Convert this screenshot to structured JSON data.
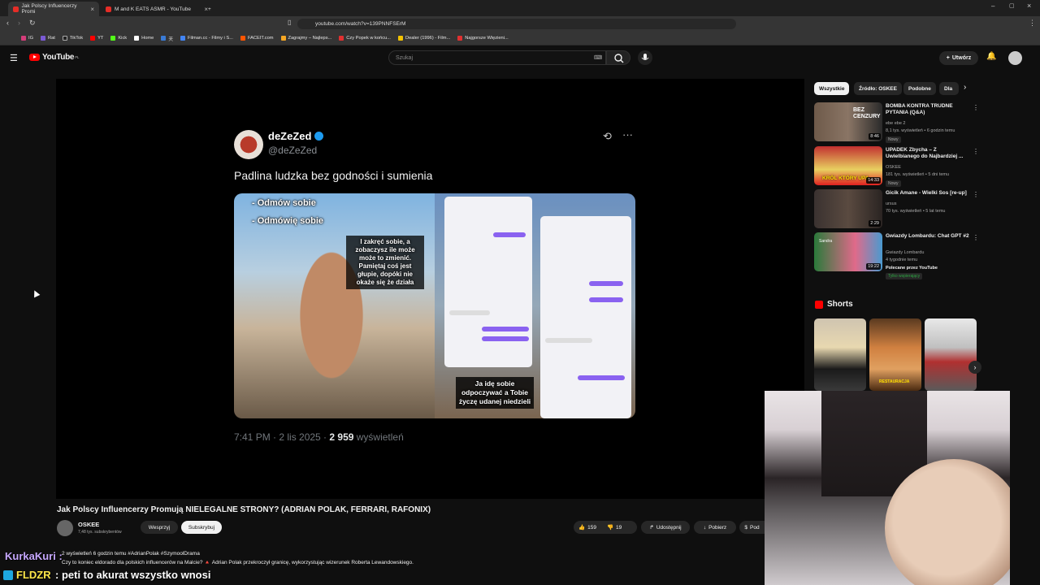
{
  "browser": {
    "tabs": [
      {
        "label": "Jak Polscy Influencerzy Promi"
      },
      {
        "label": "M and K EATS ASMR - YouTube"
      }
    ],
    "url": "youtube.com/watch?v=139PNNFSErM",
    "bookmarks": [
      "IG",
      "Rat",
      "TikTok",
      "YT",
      "Kick",
      "Home",
      "天",
      "Filman.cc - Filmy i S...",
      "FACEIT.com",
      "Zagrajmy – Najleps...",
      "Czy Popek w końcu...",
      "Dealer (1996) - Film...",
      "Najgorsze Więzieni..."
    ]
  },
  "header": {
    "logo": "YouTube",
    "logo_country": "PL",
    "search_placeholder": "Szukaj",
    "create_label": "Utwórz"
  },
  "tweet": {
    "display_name": "deZeZed",
    "handle": "@deZeZed",
    "text": "Padlina ludzka bez godności i sumienia",
    "caption_top1": "- Odmów sobie",
    "caption_top2": "- Odmówię sobie",
    "caption_mid": "I zakręć sobie, a zobaczysz ile może może to zmienić. Pamiętaj coś jest głupie, dopóki nie okaże się że działa",
    "caption_bottom": "Ja idę sobie odpoczywać a Tobie życzę udanej niedzieli",
    "time": "7:41 PM · 2 lis 2025 · ",
    "views_count": "2 959",
    "views_label": " wyświetleń"
  },
  "video": {
    "title": "Jak Polscy Influencerzy Promują NIELEGALNE STRONY? (ADRIAN POLAK, FERRARI, RAFONIX)",
    "channel": "OSKEE",
    "subscribers": "7,48 tys. subskrybentów",
    "support_label": "Wesprzyj",
    "subscribe_label": "Subskrybuj",
    "likes": "159",
    "dislikes": "19",
    "share_label": "Udostępnij",
    "download_label": "Pobierz",
    "more_label": "Pod",
    "desc_line1": "2 wyświetleń  6 godzin temu  #AdrianPolak #SzymoolDrama",
    "desc_line2": "Czy to koniec eldorado dla polskich influencerów na Malcie? 🔺 Adrian Polak przekroczył granicę, wykorzystując wizerunek Roberta Lewandowskiego."
  },
  "chips": [
    "Wszystkie",
    "Źródło: OSKEE",
    "Podobne",
    "Dla"
  ],
  "recommendations": [
    {
      "title": "BOMBA KONTRA TRUDNE PYTANIA (Q&A)",
      "channel": "ebe ebe 2",
      "meta": "8,1 tys. wyświetleń • 6 godzin temu",
      "badge": "Nowy",
      "duration": "8:46",
      "thumb_text": "BEZ CENZURY"
    },
    {
      "title": "UPADEK Zbycha – Z Uwielbianego do Najbardziej ...",
      "channel": "OSKEE",
      "meta": "181 tys. wyświetleń • 5 dni temu",
      "badge": "Nowy",
      "duration": "14:33",
      "thumb_text": "KRÓL KTÓRY UPA"
    },
    {
      "title": "Gicik Amane - Wielki Sos [re-up]",
      "channel": "ursus",
      "meta": "70 tys. wyświetleń • 5 lat temu",
      "badge": "",
      "duration": "2:29",
      "thumb_text": ""
    },
    {
      "title": "Gwiazdy Lombardu: Chat GPT #2",
      "channel": "Gwiazdy Lombardu",
      "meta": "4 tygodnie temu",
      "badge": "Polecane przez YouTube",
      "extra": "Tylko wspierający",
      "duration": "19:22",
      "thumb_text": "Sandra"
    }
  ],
  "shorts": {
    "title": "Shorts",
    "items": [
      {
        "label": ""
      },
      {
        "label": "RESTAURACJA"
      },
      {
        "label": ""
      }
    ]
  },
  "chat": {
    "user1": "KurkaKuri :",
    "user2": "FLDZR",
    "msg2": ": peti to akurat wszystko wnosi"
  },
  "colors": {
    "yt_red": "#ff0000",
    "bg": "#0f0f0f",
    "verified": "#1d9bf0",
    "chat_user1": "#c7a8ff",
    "chat_user2": "#ffe74a"
  }
}
